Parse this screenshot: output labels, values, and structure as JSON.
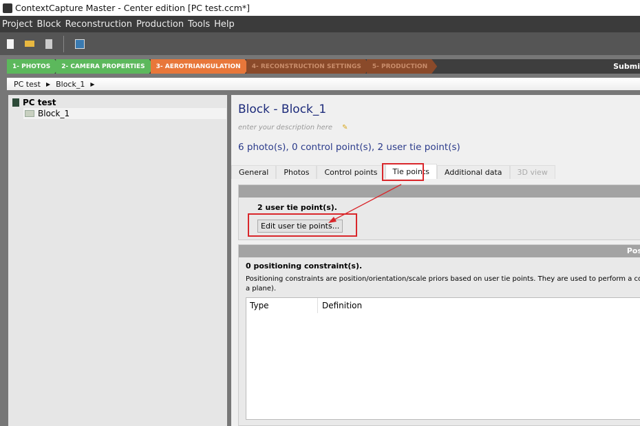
{
  "window": {
    "title": "ContextCapture Master - Center edition [PC test.ccm*]"
  },
  "menu": [
    "Project",
    "Block",
    "Reconstruction",
    "Production",
    "Tools",
    "Help"
  ],
  "toolbar": [
    "new-file-icon",
    "open-folder-icon",
    "save-icon",
    "monitor-icon"
  ],
  "steps": [
    {
      "label": "1- PHOTOS",
      "color": "#5cb85c",
      "text": "#fff"
    },
    {
      "label": "2- CAMERA PROPERTIES",
      "color": "#5cb85c",
      "text": "#fff"
    },
    {
      "label": "3- AEROTRIANGULATION",
      "color": "#e8773a",
      "text": "#fff"
    },
    {
      "label": "4- RECONSTRUCTION SETTINGS",
      "color": "#8a4a2a",
      "text": "#c98d6b"
    },
    {
      "label": "5- PRODUCTION",
      "color": "#8a4a2a",
      "text": "#c98d6b"
    }
  ],
  "submit_label": "Submi",
  "breadcrumb": [
    "PC test",
    "Block_1"
  ],
  "tree": {
    "root": "PC test",
    "child": "Block_1"
  },
  "main": {
    "title": "Block - Block_1",
    "description_placeholder": "enter your description here",
    "summary": "6 photo(s), 0 control point(s), 2 user tie point(s)",
    "tabs": [
      "General",
      "Photos",
      "Control points",
      "Tie points",
      "Additional data",
      "3D view"
    ],
    "active_tab": "Tie points",
    "tie": {
      "count": "2 user tie point(s).",
      "edit_button": "Edit user tie points..."
    },
    "positioning": {
      "header": "Pos",
      "count": "0 positioning constraint(s).",
      "description": "Positioning constraints are position/orientation/scale priors based on user tie points. They are used to perform a coars",
      "description2": "a plane).",
      "columns": [
        "Type",
        "Definition"
      ]
    }
  },
  "annotation_color": "#d9262a"
}
